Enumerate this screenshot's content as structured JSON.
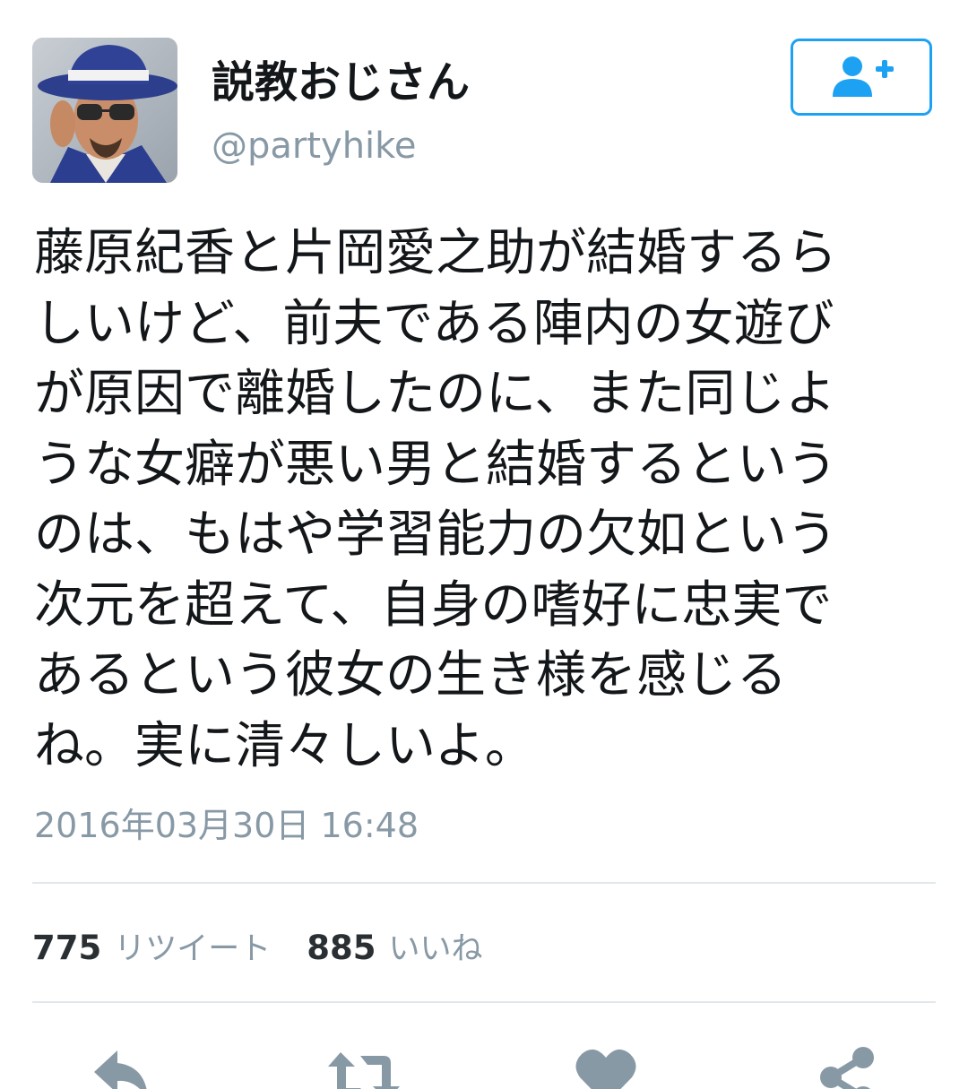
{
  "user": {
    "display_name": "説教おじさん",
    "handle": "@partyhike"
  },
  "tweet": {
    "lines": [
      "藤原紀香と片岡愛之助が結婚するら",
      "しいけど、前夫である陣内の女遊び",
      "が原因で離婚したのに、また同じよ",
      "うな女癖が悪い男と結婚するという",
      "のは、もはや学習能力の欠如という",
      "次元を超えて、自身の嗜好に忠実で",
      "あるという彼女の生き様を感じる",
      "ね。実に清々しいよ。"
    ],
    "timestamp": "2016年03月30日 16:48"
  },
  "stats": {
    "retweet_count": "775",
    "retweet_label": "リツイート",
    "like_count": "885",
    "like_label": "いいね"
  },
  "icons": {
    "follow": "add-user-icon",
    "reply": "reply-icon",
    "retweet": "retweet-icon",
    "like": "heart-icon",
    "share": "share-icon"
  },
  "colors": {
    "accent": "#1da1f2",
    "secondary_text": "#8899a6",
    "action_icon": "#8899a6",
    "divider": "#e1e8ed"
  }
}
